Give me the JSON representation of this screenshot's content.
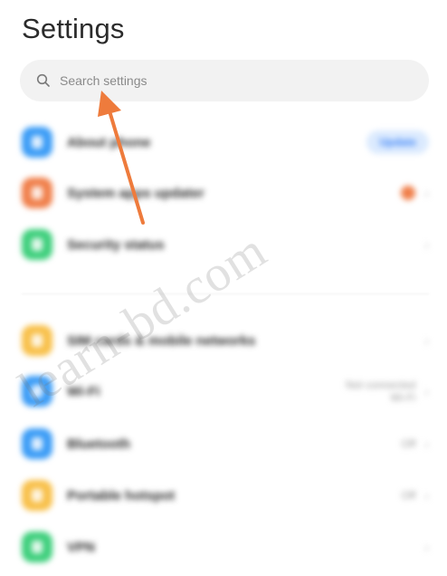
{
  "header": {
    "title": "Settings"
  },
  "search": {
    "placeholder": "Search settings",
    "icon": "search-icon"
  },
  "sections": [
    {
      "items": [
        {
          "label": "About phone",
          "icon_color": "#3b9cf6",
          "trail_badge": "Update"
        },
        {
          "label": "System apps updater",
          "icon_color": "#f07f4a",
          "trail_dot": true
        },
        {
          "label": "Security status",
          "icon_color": "#3ecf7c"
        }
      ]
    },
    {
      "items": [
        {
          "label": "SIM cards & mobile networks",
          "icon_color": "#f8c04a"
        },
        {
          "label": "Wi-Fi",
          "icon_color": "#3b9cf6",
          "value_line1": "Not connected",
          "value_line2": "Wi-Fi"
        },
        {
          "label": "Bluetooth",
          "icon_color": "#3b9cf6",
          "value": "Off"
        },
        {
          "label": "Portable hotspot",
          "icon_color": "#f8c04a",
          "value": "Off"
        },
        {
          "label": "VPN",
          "icon_color": "#3ecf7c"
        }
      ]
    }
  ],
  "watermark": "learn-bd.com",
  "annotation": {
    "arrow_color": "#ee7b3c"
  }
}
